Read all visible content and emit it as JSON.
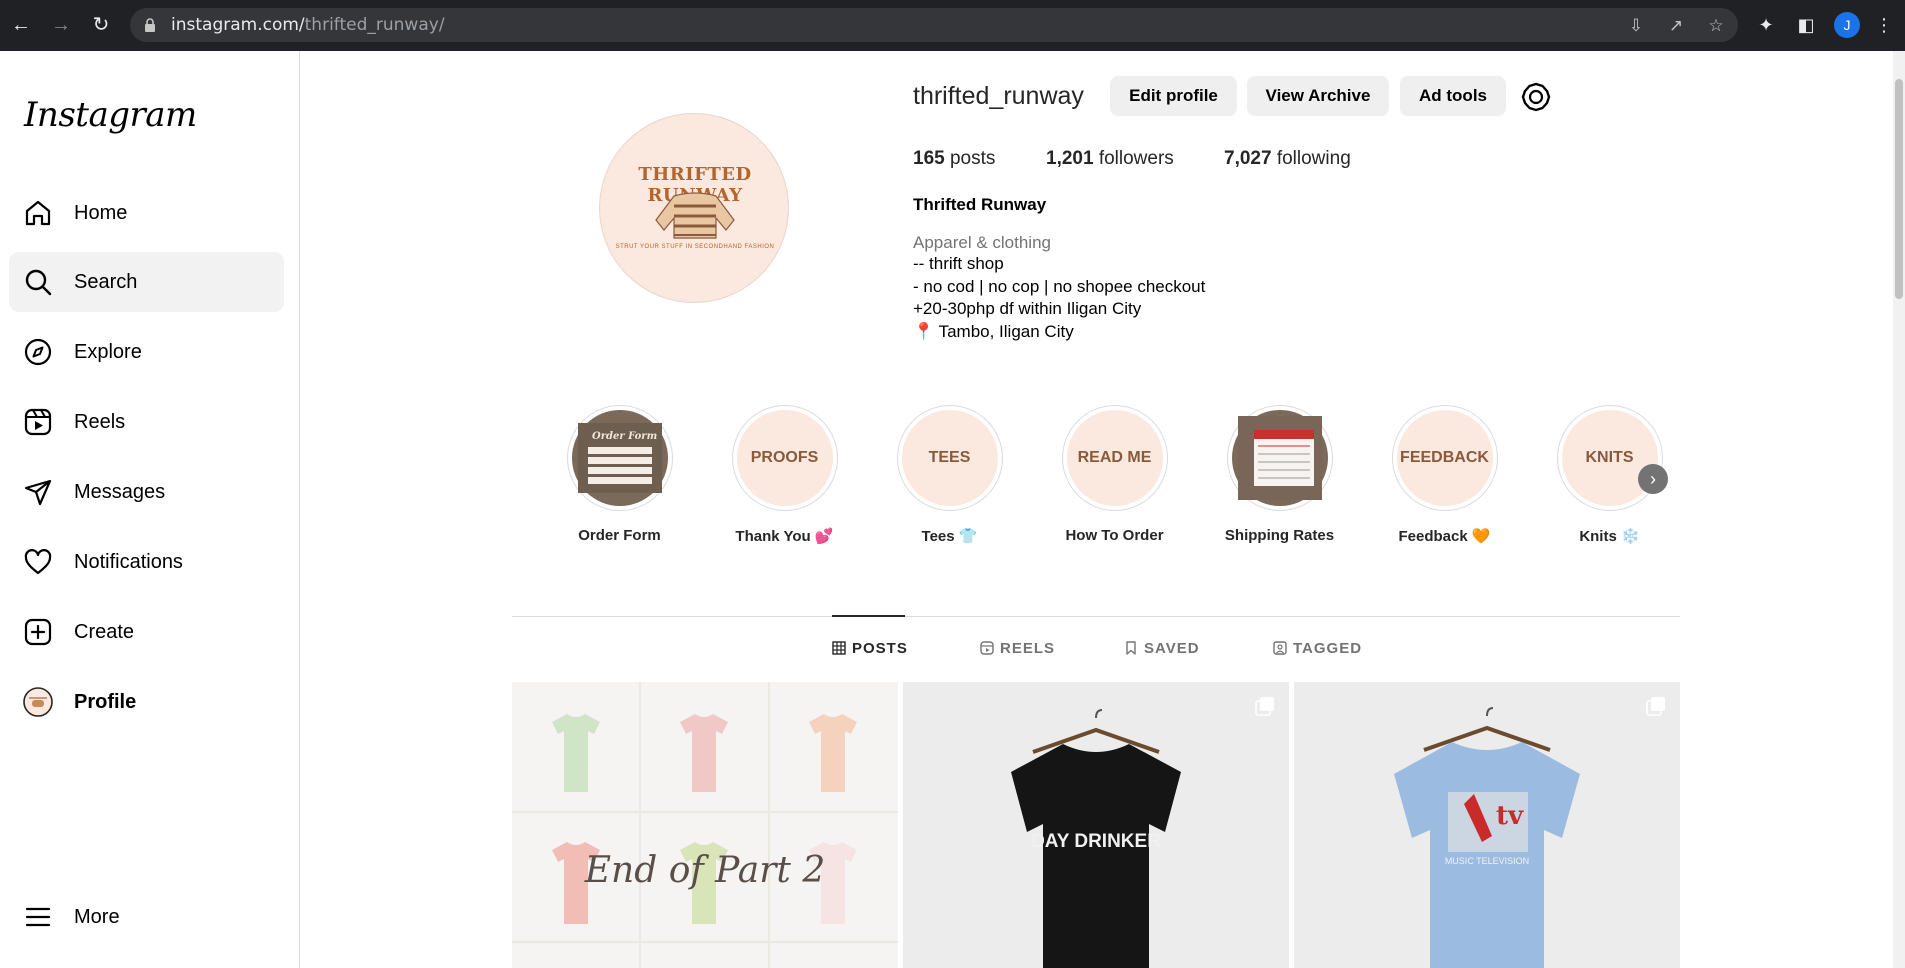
{
  "browser": {
    "url_host": "instagram.com/",
    "url_path": "thrifted_runway/",
    "avatar_letter": "J"
  },
  "sidebar": {
    "logo": "Instagram",
    "items": [
      {
        "label": "Home",
        "icon": "home-icon"
      },
      {
        "label": "Search",
        "icon": "search-icon"
      },
      {
        "label": "Explore",
        "icon": "compass-icon"
      },
      {
        "label": "Reels",
        "icon": "reels-icon"
      },
      {
        "label": "Messages",
        "icon": "paper-plane-icon"
      },
      {
        "label": "Notifications",
        "icon": "heart-icon"
      },
      {
        "label": "Create",
        "icon": "plus-square-icon"
      },
      {
        "label": "Profile",
        "icon": "avatar-icon"
      }
    ],
    "more": "More",
    "active": "Search"
  },
  "profile": {
    "username": "thrifted_runway",
    "avatar_brand": "THRIFTED RUNWAY",
    "avatar_tagline": "STRUT YOUR STUFF IN SECONDHAND FASHION",
    "buttons": {
      "edit": "Edit profile",
      "archive": "View Archive",
      "ad_tools": "Ad tools"
    },
    "stats": {
      "posts_count": "165",
      "posts_label": "posts",
      "followers_count": "1,201",
      "followers_label": "followers",
      "following_count": "7,027",
      "following_label": "following"
    },
    "full_name": "Thrifted Runway",
    "category": "Apparel & clothing",
    "bio": [
      "-- thrift shop",
      "- no cod | no cop | no shopee checkout",
      "+20-30php df within Iligan City",
      "📍 Tambo, Iligan City"
    ]
  },
  "highlights": [
    {
      "cover": "Order Form",
      "label": "Order Form",
      "photo": true
    },
    {
      "cover": "PROOFS",
      "label": "Thank You 💕",
      "photo": false
    },
    {
      "cover": "TEES",
      "label": "Tees 👕",
      "photo": false
    },
    {
      "cover": "READ ME",
      "label": "How To Order",
      "photo": false
    },
    {
      "cover": "",
      "label": "Shipping Rates",
      "photo": true
    },
    {
      "cover": "FEEDBACK",
      "label": "Feedback 🧡",
      "photo": false
    },
    {
      "cover": "KNITS",
      "label": "Knits ❄️",
      "photo": false
    }
  ],
  "tabs": [
    {
      "label": "POSTS",
      "active": true
    },
    {
      "label": "REELS",
      "active": false
    },
    {
      "label": "SAVED",
      "active": false
    },
    {
      "label": "TAGGED",
      "active": false
    }
  ],
  "posts": [
    {
      "caption": "End of Part 2"
    },
    {
      "shirt_text": "DAY DRINKER",
      "shirt_color": "#151515"
    },
    {
      "shirt_text": "MUSIC TELEVISION",
      "shirt_color": "#9bbbe0"
    }
  ]
}
